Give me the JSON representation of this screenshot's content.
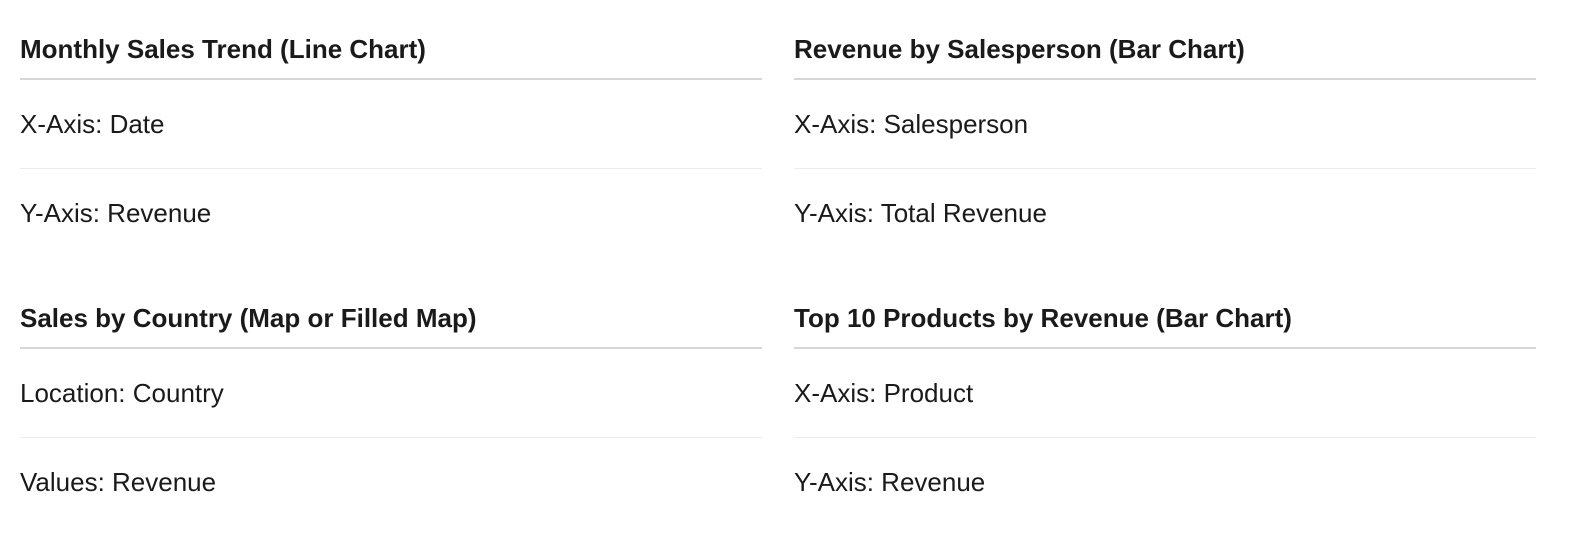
{
  "sections": [
    {
      "title": "Monthly Sales Trend (Line Chart)",
      "rows": [
        "X-Axis: Date",
        "Y-Axis: Revenue"
      ]
    },
    {
      "title": "Revenue by Salesperson (Bar Chart)",
      "rows": [
        "X-Axis: Salesperson",
        "Y-Axis: Total Revenue"
      ]
    },
    {
      "title": "Sales by Country (Map or Filled Map)",
      "rows": [
        "Location: Country",
        "Values: Revenue"
      ]
    },
    {
      "title": "Top 10 Products by Revenue (Bar Chart)",
      "rows": [
        "X-Axis: Product",
        "Y-Axis: Revenue"
      ]
    }
  ]
}
